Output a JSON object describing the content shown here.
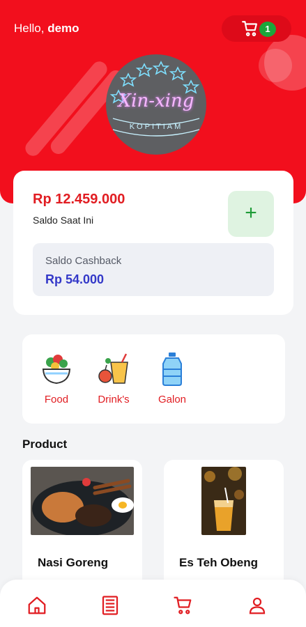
{
  "header": {
    "greeting_prefix": "Hello, ",
    "username": "demo",
    "cart_count": "1"
  },
  "logo": {
    "brand": "Xin-xing",
    "subtitle": "KOPITIAM"
  },
  "balance": {
    "amount": "Rp 12.459.000",
    "label": "Saldo Saat Ini",
    "add_label": "+",
    "cashback_label": "Saldo Cashback",
    "cashback_amount": "Rp 54.000"
  },
  "categories": [
    {
      "label": "Food",
      "icon": "salad-bowl-icon"
    },
    {
      "label": "Drink's",
      "icon": "drinks-icon"
    },
    {
      "label": "Galon",
      "icon": "water-gallon-icon"
    }
  ],
  "products": {
    "title": "Product",
    "items": [
      {
        "name": "Nasi Goreng"
      },
      {
        "name": "Es Teh Obeng"
      }
    ]
  },
  "nav": [
    "home-icon",
    "order-list-icon",
    "cart-icon",
    "profile-icon"
  ],
  "colors": {
    "primary_red": "#f20f1d",
    "accent_green": "#1ca53b",
    "cashback_blue": "#3338c8"
  }
}
